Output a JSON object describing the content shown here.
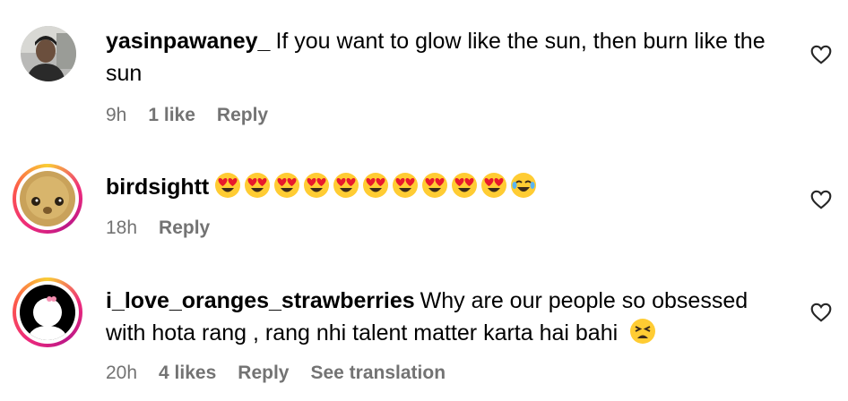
{
  "comments": [
    {
      "username": "yasinpawaney_",
      "text": "If you want to glow like the sun, then burn like the sun",
      "time": "9h",
      "likes": "1 like",
      "reply": "Reply"
    },
    {
      "username": "birdsightt",
      "time": "18h",
      "reply": "Reply",
      "emoji_icons": [
        "heart-eyes",
        "heart-eyes",
        "heart-eyes",
        "heart-eyes",
        "heart-eyes",
        "heart-eyes",
        "heart-eyes",
        "heart-eyes",
        "heart-eyes",
        "heart-eyes",
        "tears-of-joy"
      ]
    },
    {
      "username": "i_love_oranges_strawberries",
      "text_line1": "Why are our people so obsessed",
      "text_line2": "with hota rang , rang nhi talent matter karta hai bahi",
      "time": "20h",
      "likes": "4 likes",
      "reply": "Reply",
      "translate": "See translation",
      "trailing_emoji": "tired-face"
    }
  ],
  "colors": {
    "meta_gray": "#737373",
    "story_ring": [
      "#f9ce34",
      "#ee2a7b",
      "#bc1888"
    ],
    "emoji_yellow": "#ffcc33",
    "emoji_heart": "#e8192c"
  },
  "icons": {
    "like": "heart-outline-icon"
  }
}
